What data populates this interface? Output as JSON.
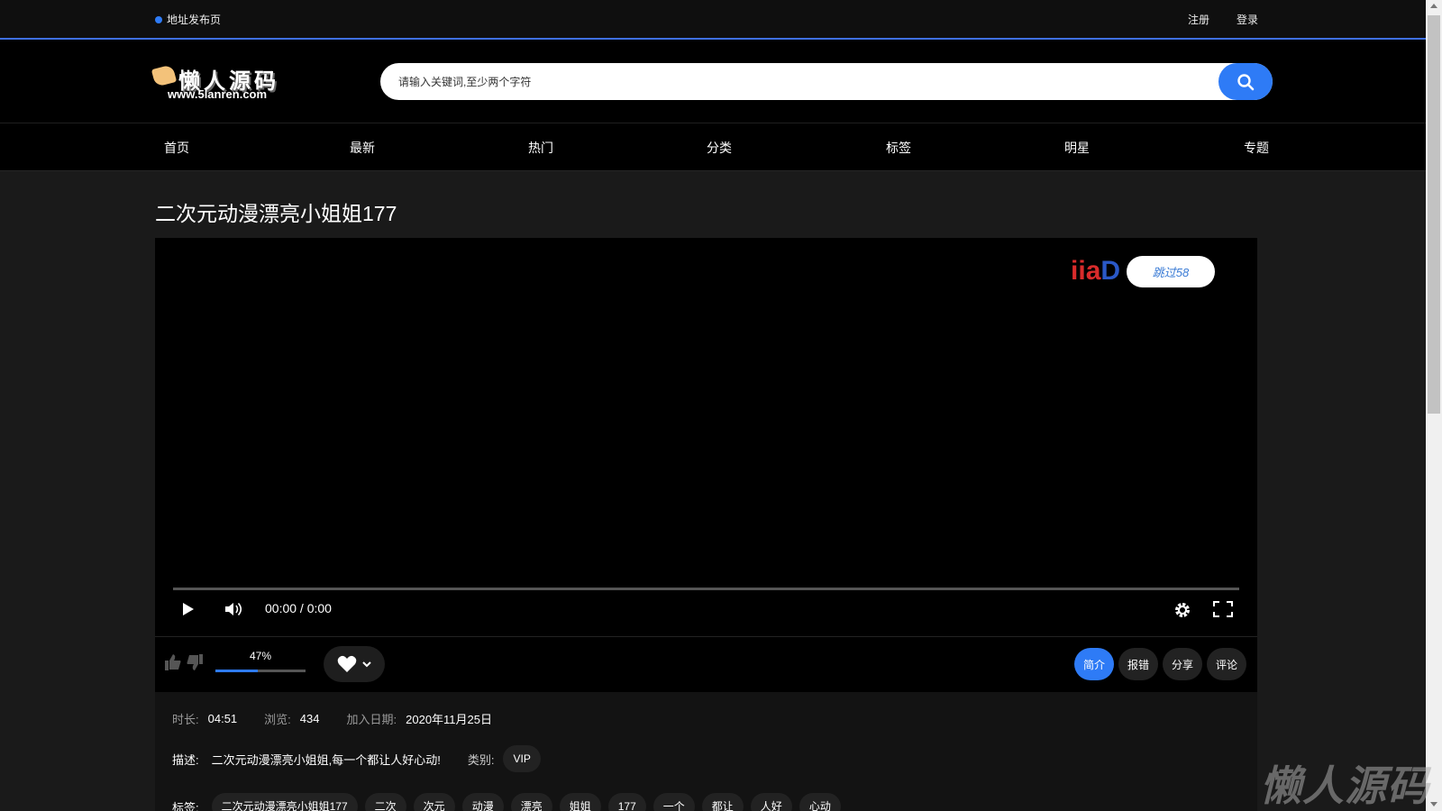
{
  "topbar": {
    "notice": "地址发布页",
    "register": "注册",
    "login": "登录"
  },
  "logo": {
    "cn": "懒人源码",
    "url": "www.5lanren.com"
  },
  "search": {
    "placeholder": "请输入关键词,至少两个字符"
  },
  "nav": [
    "首页",
    "最新",
    "热门",
    "分类",
    "标签",
    "明星",
    "专题"
  ],
  "video": {
    "title": "二次元动漫漂亮小姐姐177",
    "ad_logo": "iiaD",
    "skip_label": "跳过58",
    "time": "00:00 / 0:00"
  },
  "rating": {
    "percent_label": "47%",
    "percent": 47
  },
  "tabs": [
    "简介",
    "报错",
    "分享",
    "评论"
  ],
  "info": {
    "duration_label": "时长:",
    "duration": "04:51",
    "views_label": "浏览:",
    "views": "434",
    "date_label": "加入日期:",
    "date": "2020年11月25日",
    "desc_label": "描述:",
    "desc": "二次元动漫漂亮小姐姐,每一个都让人好心动!",
    "category_label": "类别:",
    "category": "VIP",
    "tags_label": "标签:",
    "tags": [
      "二次元动漫漂亮小姐姐177",
      "二次",
      "次元",
      "动漫",
      "漂亮",
      "姐姐",
      "177",
      "一个",
      "都让",
      "人好",
      "心动"
    ]
  },
  "watermark": "懒人源码",
  "colors": {
    "accent": "#2e7bf6",
    "background": "#1a1a1a"
  }
}
